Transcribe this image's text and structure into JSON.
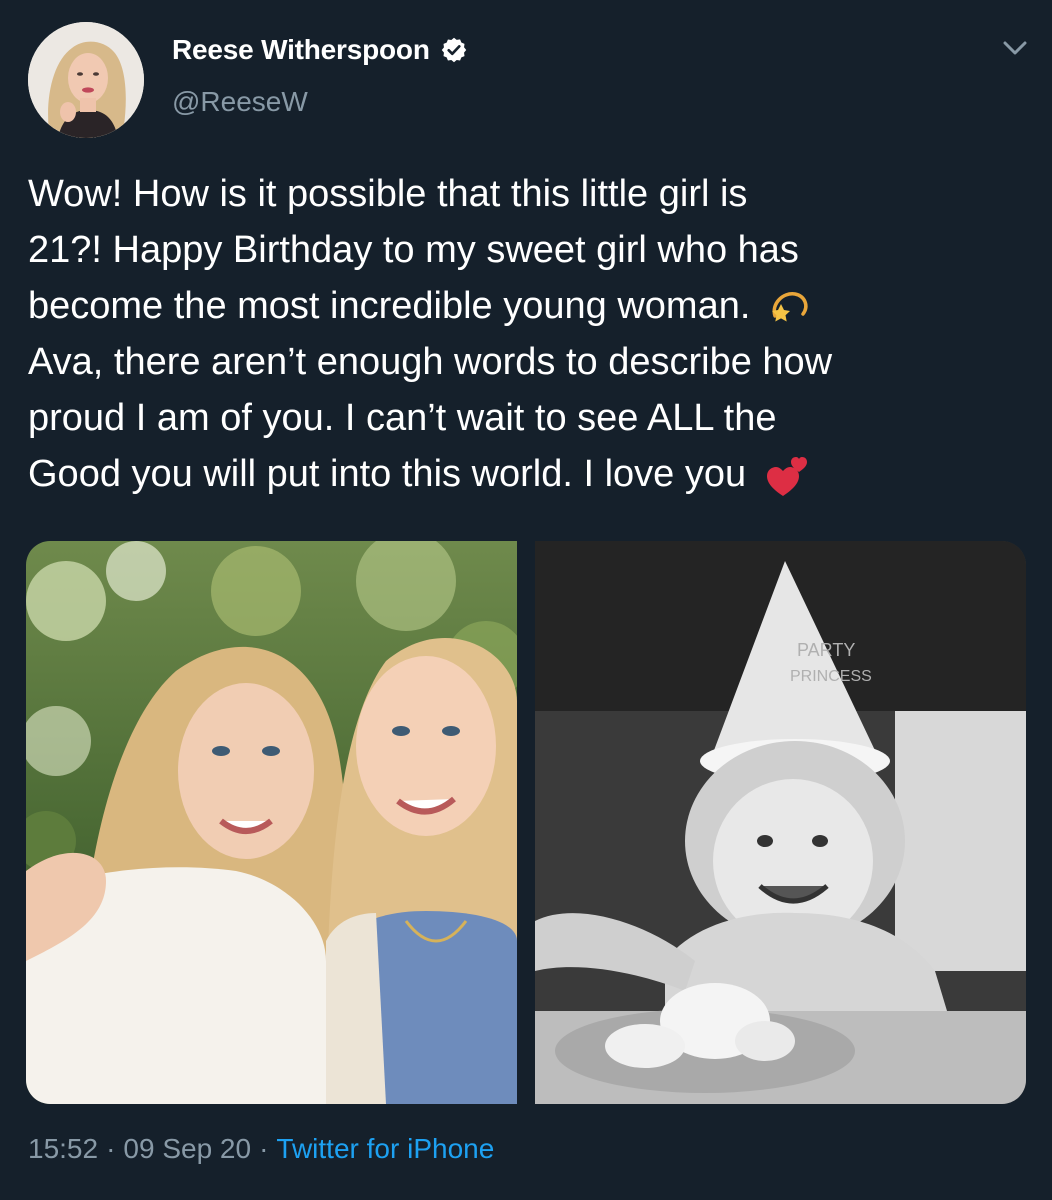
{
  "author": {
    "display_name": "Reese Witherspoon",
    "handle": "@ReeseW",
    "verified": true,
    "avatar_icon": "profile-photo"
  },
  "tweet": {
    "lines": [
      "Wow! How is it possible that this little girl is",
      "21?! Happy Birthday to my sweet girl who has",
      "become the most incredible young woman.",
      "Ava, there aren’t enough words to describe how",
      "proud I am of you. I can’t wait to see ALL the",
      "Good you will put into this world. I love you"
    ],
    "emoji_1": "dizzy-star-emoji",
    "emoji_2": "two-hearts-emoji"
  },
  "media": {
    "photo_1": "color photo of two smiling blonde women outdoors",
    "photo_2": "black and white photo of toddler in party hat with cake",
    "hat_text_line1": "PARTY",
    "hat_text_line2": "PRINCESS"
  },
  "meta": {
    "time": "15:52",
    "separator": "·",
    "date": "09 Sep 20",
    "source": "Twitter for iPhone"
  },
  "colors": {
    "background": "#15202b",
    "text": "#ffffff",
    "secondary": "#8899a6",
    "link": "#1da1f2"
  }
}
